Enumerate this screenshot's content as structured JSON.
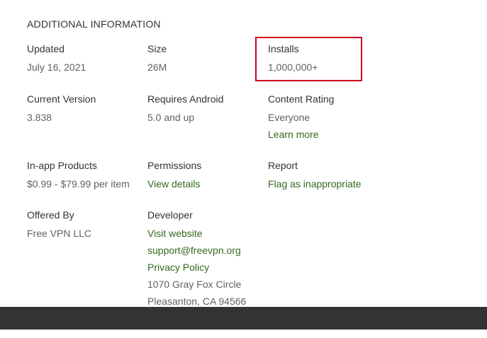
{
  "section": {
    "title": "ADDITIONAL INFORMATION"
  },
  "details": {
    "updated": {
      "label": "Updated",
      "value": "July 16, 2021"
    },
    "size": {
      "label": "Size",
      "value": "26M"
    },
    "installs": {
      "label": "Installs",
      "value": "1,000,000+"
    },
    "current_version": {
      "label": "Current Version",
      "value": "3.838"
    },
    "requires_android": {
      "label": "Requires Android",
      "value": "5.0 and up"
    },
    "content_rating": {
      "label": "Content Rating",
      "value": "Everyone",
      "link": "Learn more"
    },
    "in_app_products": {
      "label": "In-app Products",
      "value": "$0.99 - $79.99 per item"
    },
    "permissions": {
      "label": "Permissions",
      "link": "View details"
    },
    "report": {
      "label": "Report",
      "link": "Flag as inappropriate"
    },
    "offered_by": {
      "label": "Offered By",
      "value": "Free VPN LLC"
    },
    "developer": {
      "label": "Developer",
      "website_link": "Visit website",
      "email_link": "support@freevpn.org",
      "privacy_link": "Privacy Policy",
      "address_line1": "1070 Gray Fox Circle",
      "address_line2": "Pleasanton, CA 94566"
    }
  },
  "colors": {
    "label": "#333333",
    "value": "#616161",
    "link": "#33691e",
    "highlight": "#d0021b",
    "footer": "#333333"
  }
}
